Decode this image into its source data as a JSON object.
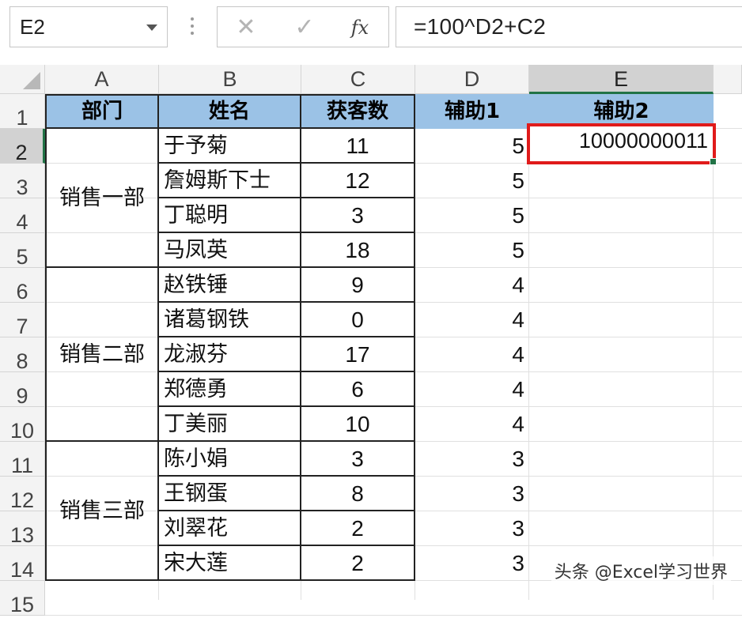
{
  "formula_bar": {
    "name_box": "E2",
    "cancel_icon": "close-icon",
    "enter_icon": "check-icon",
    "fx_label": "fx",
    "formula": "=100^D2+C2"
  },
  "columns": [
    "A",
    "B",
    "C",
    "D",
    "E"
  ],
  "rows": [
    "1",
    "2",
    "3",
    "4",
    "5",
    "6",
    "7",
    "8",
    "9",
    "10",
    "11",
    "12",
    "13",
    "14",
    "15"
  ],
  "header": {
    "a": "部门",
    "b": "姓名",
    "c": "获客数",
    "d": "辅助1",
    "e": "辅助2"
  },
  "departments": [
    "销售一部",
    "销售二部",
    "销售三部"
  ],
  "records": [
    {
      "name": "于予菊",
      "count": "11",
      "aux1": "5"
    },
    {
      "name": "詹姆斯下士",
      "count": "12",
      "aux1": "5"
    },
    {
      "name": "丁聪明",
      "count": "3",
      "aux1": "5"
    },
    {
      "name": "马凤英",
      "count": "18",
      "aux1": "5"
    },
    {
      "name": "赵铁锤",
      "count": "9",
      "aux1": "4"
    },
    {
      "name": "诸葛钢铁",
      "count": "0",
      "aux1": "4"
    },
    {
      "name": "龙淑芬",
      "count": "17",
      "aux1": "4"
    },
    {
      "name": "郑德勇",
      "count": "6",
      "aux1": "4"
    },
    {
      "name": "丁美丽",
      "count": "10",
      "aux1": "4"
    },
    {
      "name": "陈小娟",
      "count": "3",
      "aux1": "3"
    },
    {
      "name": "王钢蛋",
      "count": "8",
      "aux1": "3"
    },
    {
      "name": "刘翠花",
      "count": "2",
      "aux1": "3"
    },
    {
      "name": "宋大莲",
      "count": "2",
      "aux1": "3"
    }
  ],
  "e2_value": "10000000011",
  "watermark": "头条 @Excel学习世界",
  "colors": {
    "header_fill": "#9bc2e6",
    "selection_outline": "#e01b1b",
    "excel_green": "#217346"
  }
}
